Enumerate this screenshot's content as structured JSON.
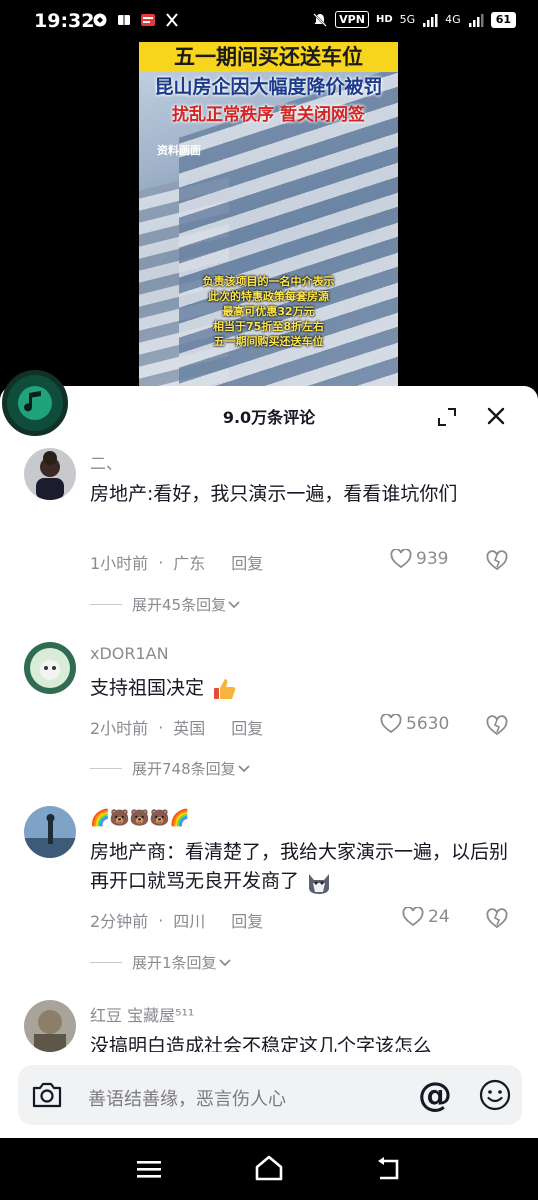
{
  "status_bar": {
    "time": "19:32",
    "vpn": "VPN",
    "hd": "HD",
    "net1": "5G",
    "net2": "4G",
    "battery": "61"
  },
  "video": {
    "headline_1": "五一期间买还送车位",
    "headline_2": "昆山房企因大幅度降价被罚",
    "headline_3": "扰乱正常秩序 暂关闭网签",
    "tag": "资料画面",
    "subtitles": [
      "负责该项目的一名中介表示",
      "此次的特惠政策每套房源",
      "最高可优惠32万元",
      "相当于75折至8折左右",
      "五一期间购买还送车位"
    ]
  },
  "sheet": {
    "title": "9.0万条评论"
  },
  "comments": [
    {
      "name": "二、",
      "text": "房地产:看好，我只演示一遍，看看谁坑你们",
      "time": "1小时前",
      "location": "广东",
      "reply_label": "回复",
      "likes": "939",
      "expand": "展开45条回复"
    },
    {
      "name": "xDOR1AN",
      "text": "支持祖国决定",
      "time": "2小时前",
      "location": "英国",
      "reply_label": "回复",
      "likes": "5630",
      "expand": "展开748条回复"
    },
    {
      "name": "🌈🐻🐻🐻🌈",
      "text": "房地产商：看清楚了，我给大家演示一遍，以后别再开口就骂无良开发商了",
      "time": "2分钟前",
      "location": "四川",
      "reply_label": "回复",
      "likes": "24",
      "expand": "展开1条回复"
    },
    {
      "name": "红豆  宝藏屋⁵¹¹",
      "text": "没搞明白造成社会不稳定这几个字该怎么"
    }
  ],
  "input": {
    "placeholder": "善语结善缘，恶言伤人心"
  },
  "icons": [
    "camera-icon",
    "at-icon",
    "smile-icon",
    "heart-icon",
    "dislike-icon",
    "close-icon",
    "expand-icon",
    "music-icon"
  ],
  "colors": {
    "accent_yellow": "#f7d51c",
    "text_primary": "#161823",
    "text_secondary": "#8a8b91"
  }
}
